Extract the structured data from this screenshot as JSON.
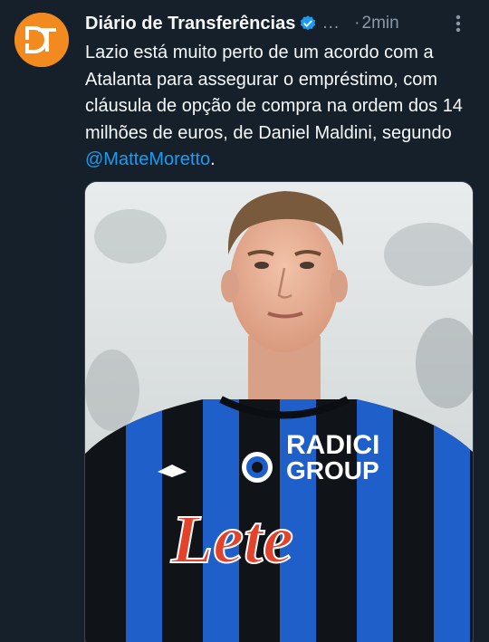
{
  "tweet": {
    "author_name": "Diário de Transferências",
    "handle_truncated": "...",
    "separator": "·",
    "time": "2min",
    "text_part1": "Lazio está muito perto de um acordo com a Atalanta para assegurar o empréstimo, com cláusula de opção de compra na ordem dos 14 milhões de euros, de Daniel Maldini, segundo ",
    "mention": "@MatteMoretto",
    "text_end": ".",
    "avatar_icon": "dt-logo-icon",
    "verified_icon": "verified-badge-icon",
    "more_icon": "more-vertical-icon"
  },
  "media": {
    "sponsor_line1": "RADICI",
    "sponsor_line2": "GROUP",
    "shirt_brand": "Lete",
    "colors": {
      "stripe_black": "#101418",
      "stripe_blue": "#1f5fc9",
      "lete_red": "#e2432a"
    }
  },
  "colors": {
    "background": "#15202b",
    "text": "#f7f9f9",
    "muted": "#8b98a5",
    "link": "#1d9bf0",
    "avatar_orange": "#f28a1f"
  }
}
